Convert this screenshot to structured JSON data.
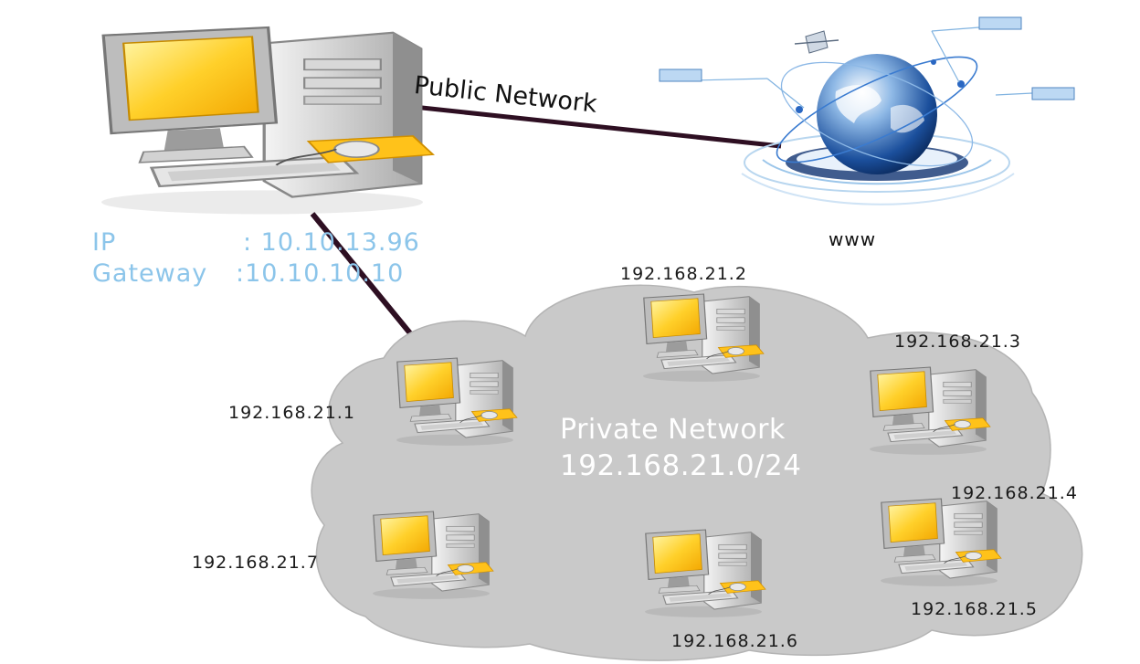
{
  "main_pc": {
    "ip_key": "IP",
    "ip_value": ": 10.10.13.96",
    "gateway_key": "Gateway",
    "gateway_value": ":10.10.10.10"
  },
  "public_network_label": "Public Network",
  "www_label": "www",
  "private_network": {
    "title": "Private Network",
    "subnet": "192.168.21.0/24",
    "hosts": [
      "192.168.21.1",
      "192.168.21.2",
      "192.168.21.3",
      "192.168.21.4",
      "192.168.21.5",
      "192.168.21.6",
      "192.168.21.7"
    ]
  },
  "colors": {
    "cloud_fill": "#c9c9c9",
    "link": "#2e0f22",
    "address_text": "#8cc5ea",
    "screen": "#f7c21e"
  }
}
